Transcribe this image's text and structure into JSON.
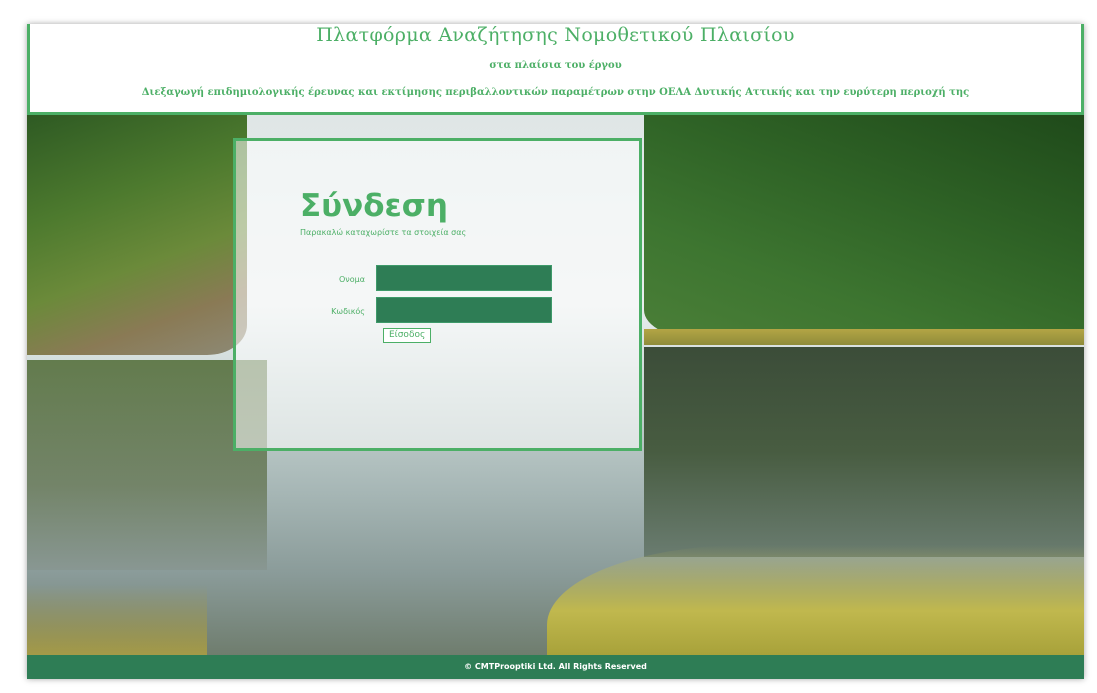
{
  "header": {
    "title": "Πλατφόρμα Αναζήτησης Νομοθετικού Πλαισίου",
    "subtitle": "στα πλαίσια του έργου",
    "project": "Διεξαγωγή επιδημιολογικής έρευνας και εκτίμησης περιβαλλοντικών παραμέτρων στην ΟΕΛΑ Δυτικής Αττικής και την ευρύτερη περιοχή της"
  },
  "login": {
    "title": "Σύνδεση",
    "instructions": "Παρακαλώ καταχωρίστε τα στοιχεία σας",
    "username_label": "Ονομα",
    "username_value": "",
    "password_label": "Κωδικός",
    "password_value": "",
    "submit_label": "Είσοδος"
  },
  "footer": {
    "copyright": "© CMTProoptiki Ltd. All Rights Reserved"
  },
  "colors": {
    "accent": "#4caf66",
    "dark_green": "#2e7d55"
  }
}
